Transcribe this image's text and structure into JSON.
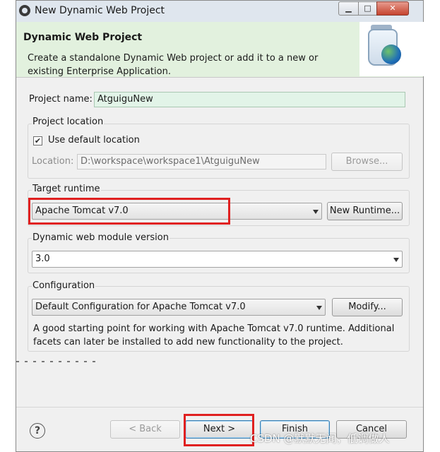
{
  "window": {
    "title": "New Dynamic Web Project",
    "minimize_glyph": "▁",
    "maximize_glyph": "□",
    "close_glyph": "✕"
  },
  "banner": {
    "title": "Dynamic Web Project",
    "description": "Create a standalone Dynamic Web project or add it to a new or existing Enterprise Application.",
    "icon": "jar-globe-icon"
  },
  "project_name": {
    "label": "Project name:",
    "value": "AtguiguNew"
  },
  "project_location": {
    "group_label": "Project location",
    "use_default_label": "Use default location",
    "use_default_checked": true,
    "location_label": "Location:",
    "location_value": "D:\\workspace\\workspace1\\AtguiguNew",
    "browse_label": "Browse..."
  },
  "target_runtime": {
    "group_label": "Target runtime",
    "selected": "Apache Tomcat v7.0",
    "new_runtime_label": "New Runtime..."
  },
  "module_version": {
    "group_label": "Dynamic web module version",
    "selected": "3.0"
  },
  "configuration": {
    "group_label": "Configuration",
    "selected": "Default Configuration for Apache Tomcat v7.0",
    "modify_label": "Modify...",
    "description": "A good starting point for working with Apache Tomcat v7.0 runtime. Additional facets can later be installed to add new functionality to the project."
  },
  "footer": {
    "help_glyph": "?",
    "back_label": "< Back",
    "next_label": "Next >",
    "finish_label": "Finish",
    "cancel_label": "Cancel"
  },
  "watermark": "CSDN @默默无闻，低调做人",
  "colors": {
    "highlight_box": "#e02020",
    "banner_bg": "#e2f1de",
    "input_highlight": "#e2f4e8"
  }
}
